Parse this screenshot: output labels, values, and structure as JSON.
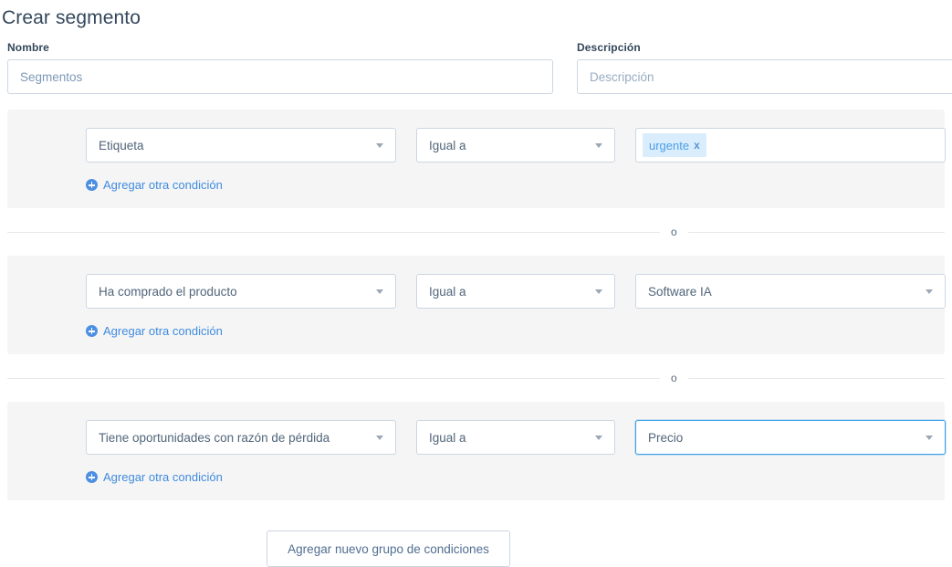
{
  "page": {
    "title": "Crear segmento"
  },
  "form": {
    "name_field": {
      "label": "Nombre",
      "value": "Segmentos",
      "placeholder": "Nombre"
    },
    "description_field": {
      "label": "Descripción",
      "value": "",
      "placeholder": "Descripción"
    }
  },
  "or_separator": "o",
  "groups": [
    {
      "property": "Etiqueta",
      "operator": "Igual a",
      "value_type": "tokens",
      "tokens": [
        {
          "label": "urgente",
          "remove_label": "x"
        }
      ],
      "add_condition_label": "Agregar otra condición",
      "focused": false
    },
    {
      "property": "Ha comprado el producto",
      "operator": "Igual a",
      "value_type": "select",
      "value": "Software IA",
      "add_condition_label": "Agregar otra condición",
      "focused": false
    },
    {
      "property": "Tiene oportunidades con razón de pérdida",
      "operator": "Igual a",
      "value_type": "select",
      "value": "Precio",
      "add_condition_label": "Agregar otra condición",
      "focused": true
    }
  ],
  "footer": {
    "add_group_label": "Agregar nuevo grupo de condiciones"
  },
  "colors": {
    "accent_link": "#3f8be0",
    "panel_bg": "#f5f5f5",
    "chip_bg": "#daedfd",
    "chip_text": "#4b9ee8",
    "focus_border": "#3b9fe8",
    "input_border": "#cbd6e2",
    "text": "#33475b"
  }
}
